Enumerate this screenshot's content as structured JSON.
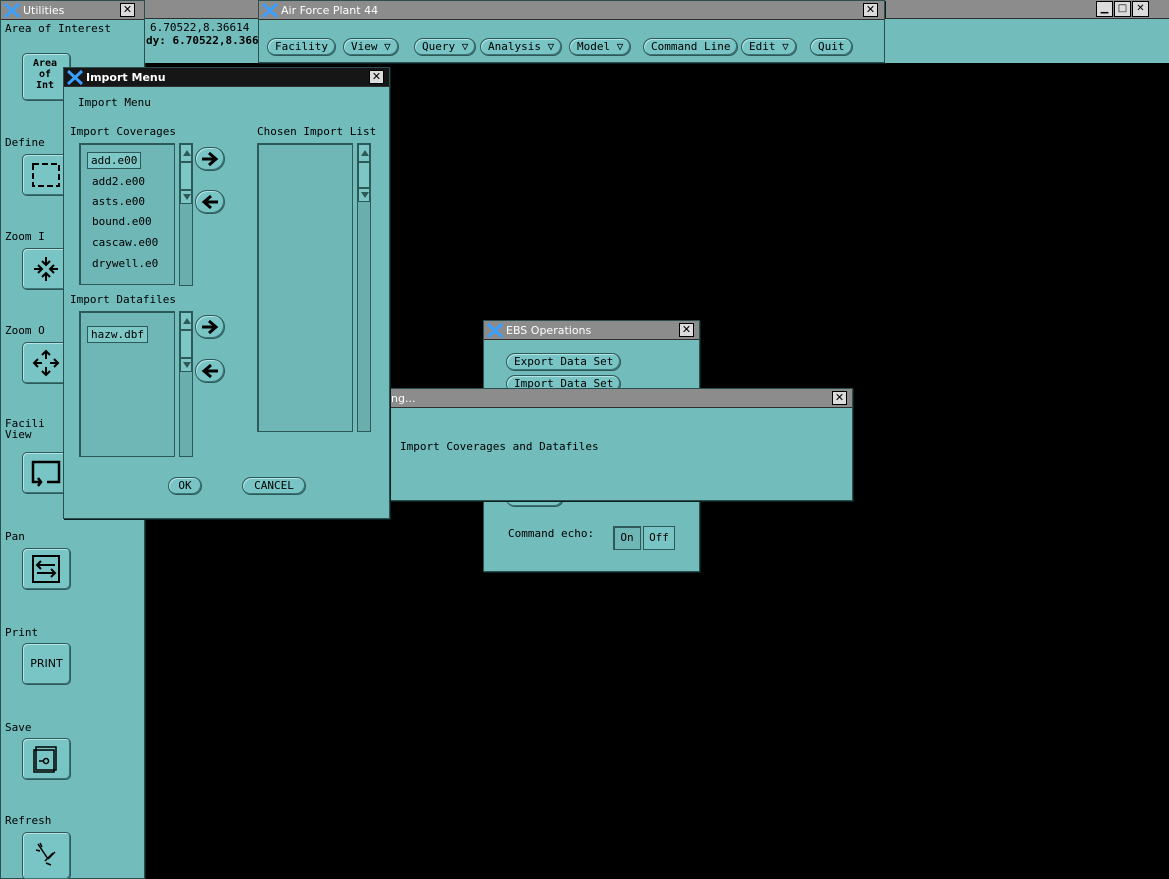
{
  "utilities": {
    "title": "Utilities",
    "aoi_label": "Area of Interest",
    "aoi_value": "6.70522,8.36614",
    "aoi_dy": "dy: 6.70522,8.366",
    "aoi_button": "Area of Int",
    "tools": [
      {
        "label": "Define"
      },
      {
        "label": "Zoom I"
      },
      {
        "label": "Zoom O"
      },
      {
        "label": "Facili View"
      },
      {
        "label": "Pan"
      },
      {
        "label": "Print",
        "button_text": "PRINT"
      },
      {
        "label": "Save"
      },
      {
        "label": "Refresh"
      }
    ]
  },
  "main_window": {
    "title": "Air Force Plant 44",
    "menu": [
      "Facility",
      "View ▽",
      "Query ▽",
      "Analysis ▽",
      "Model ▽",
      "Command Line",
      "Edit ▽",
      "Quit"
    ]
  },
  "import_menu": {
    "title": "Import Menu",
    "heading": "Import Menu",
    "coverages_label": "Import Coverages",
    "chosen_label": "Chosen Import List",
    "coverages": [
      "add.e00",
      "add2.e00",
      "asts.e00",
      "bound.e00",
      "cascaw.e00",
      "drywell.e0"
    ],
    "datafiles_label": "Import Datafiles",
    "datafiles": [
      "hazw.dbf"
    ],
    "ok": "OK",
    "cancel": "CANCEL"
  },
  "ebs_operations": {
    "title": "EBS Operations",
    "buttons": [
      "Export Data Set",
      "Import Data Set"
    ],
    "command_echo_label": "Command echo:",
    "on": "On",
    "off": "Off"
  },
  "working_dialog": {
    "title": "ng...",
    "message": "Import Coverages and Datafiles"
  },
  "colors": {
    "panel": "#72bcbc",
    "desktop": "#000000",
    "active_title": "#161616",
    "inactive_title": "#8c8c8c"
  }
}
